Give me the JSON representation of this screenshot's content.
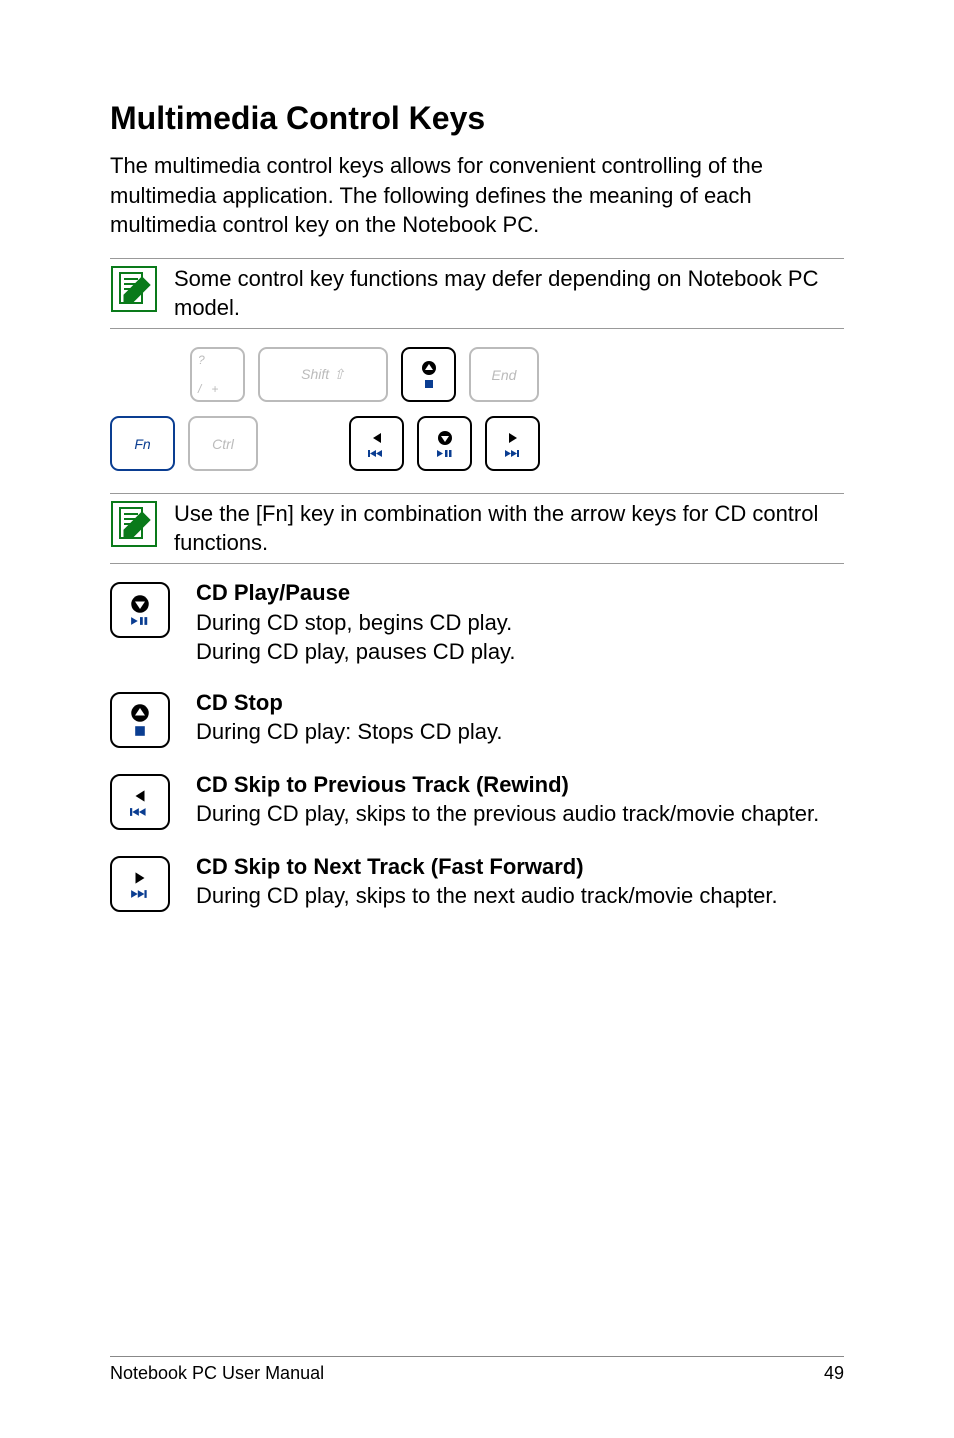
{
  "heading": "Multimedia Control Keys",
  "intro": "The multimedia control keys allows for convenient controlling of the multimedia application. The following defines the meaning of each multimedia control key on the Notebook PC.",
  "note1": "Some control key functions may defer depending on Notebook PC model.",
  "note2": "Use the [Fn] key in combination with the arrow keys for CD control functions.",
  "keys": {
    "fn": "Fn",
    "ctrl": "Ctrl",
    "shift": "Shift ⇧",
    "end": "End",
    "question_top": "?",
    "question_slash": "/",
    "question_plus": "+"
  },
  "defs": {
    "play_title": "CD Play/Pause",
    "play_l1": "During CD stop, begins CD play.",
    "play_l2": "During CD play, pauses CD play.",
    "stop_title": "CD Stop",
    "stop_l1": "During CD play: Stops CD play.",
    "prev_title": "CD Skip to Previous Track (Rewind)",
    "prev_l1": "During CD play, skips to the previous audio track/movie chapter.",
    "next_title": "CD Skip to Next Track (Fast Forward)",
    "next_l1": "During CD play, skips to the next audio track/movie chapter."
  },
  "footer": {
    "left": "Notebook PC User Manual",
    "page": "49"
  }
}
